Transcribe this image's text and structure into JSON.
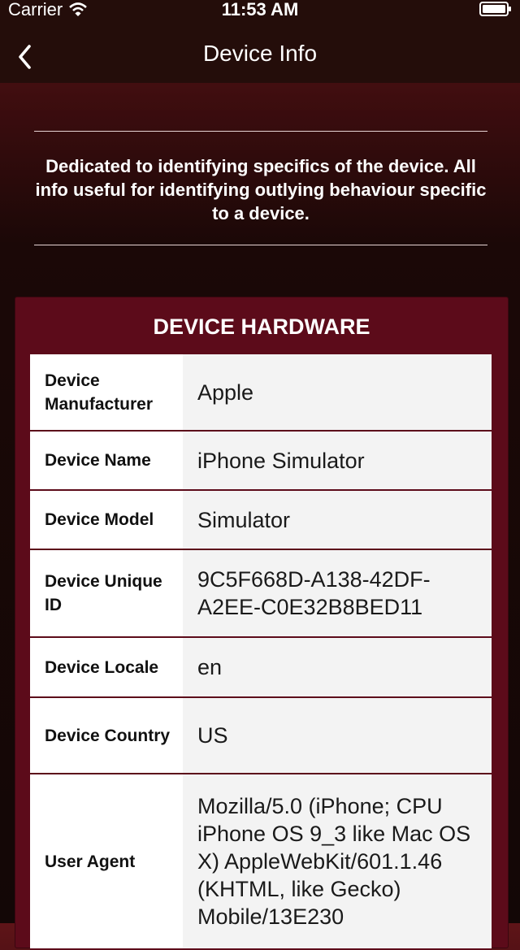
{
  "status_bar": {
    "carrier": "Carrier",
    "time": "11:53 AM"
  },
  "nav": {
    "title": "Device Info",
    "back_icon": "chevron-left-icon"
  },
  "intro_text": "Dedicated to identifying specifics of the device.  All info useful for identifying outlying behaviour specific to a device.",
  "panel": {
    "title": "DEVICE HARDWARE",
    "rows": [
      {
        "label": "Device Manufacturer",
        "value": "Apple"
      },
      {
        "label": "Device Name",
        "value": "iPhone Simulator"
      },
      {
        "label": "Device Model",
        "value": "Simulator"
      },
      {
        "label": "Device Unique ID",
        "value": "9C5F668D-A138-42DF-A2EE-C0E32B8BED11"
      },
      {
        "label": "Device Locale",
        "value": "en"
      },
      {
        "label": "Device Country",
        "value": "US"
      },
      {
        "label": "User Agent",
        "value": "Mozilla/5.0 (iPhone; CPU iPhone OS 9_3 like Mac OS X) AppleWebKit/601.1.46 (KHTML, like Gecko) Mobile/13E230"
      }
    ]
  },
  "colors": {
    "nav_background": "#240d0a",
    "panel_background": "#5c0b1a",
    "label_background": "#ffffff",
    "value_background": "#f3f3f3"
  }
}
